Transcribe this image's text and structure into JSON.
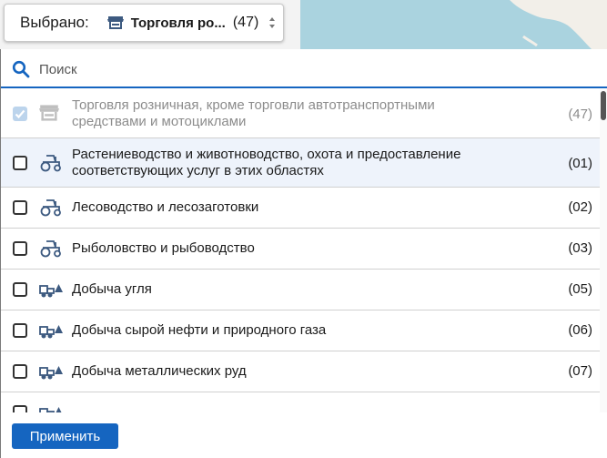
{
  "colors": {
    "accent": "#1565c0",
    "icon": "#3d5a80",
    "map_water": "#aad3df"
  },
  "selector": {
    "label": "Выбрано:",
    "icon": "store-icon",
    "value": "Торговля ро...",
    "count": "(47)"
  },
  "search": {
    "placeholder": "Поиск"
  },
  "items": [
    {
      "label": "Торговля розничная, кроме торговли автотранспортными средствами и мотоциклами",
      "code": "(47)",
      "icon": "store-icon",
      "checked": true,
      "disabled": true
    },
    {
      "label": "Растениеводство и животноводство, охота и предоставление соответствующих услуг в этих областях",
      "code": "(01)",
      "icon": "tractor-icon",
      "checked": false
    },
    {
      "label": "Лесоводство и лесозаготовки",
      "code": "(02)",
      "icon": "tractor-icon",
      "checked": false
    },
    {
      "label": "Рыболовство и рыбоводство",
      "code": "(03)",
      "icon": "tractor-icon",
      "checked": false
    },
    {
      "label": "Добыча угля",
      "code": "(05)",
      "icon": "mining-truck-icon",
      "checked": false
    },
    {
      "label": "Добыча сырой нефти и природного газа",
      "code": "(06)",
      "icon": "mining-truck-icon",
      "checked": false
    },
    {
      "label": "Добыча металлических руд",
      "code": "(07)",
      "icon": "mining-truck-icon",
      "checked": false
    }
  ],
  "footer": {
    "apply_label": "Применить"
  }
}
